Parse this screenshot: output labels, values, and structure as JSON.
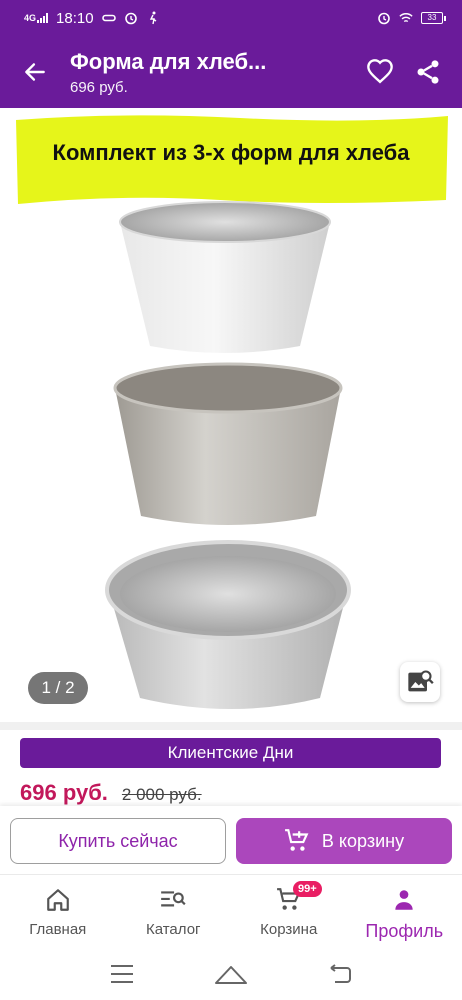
{
  "statusbar": {
    "network": "4G",
    "time": "18:10",
    "battery": "33"
  },
  "appbar": {
    "title": "Форма для хлеб...",
    "price": "696 руб."
  },
  "gallery": {
    "banner_text": "Комплект из 3-х форм для хлеба",
    "counter": "1 / 2"
  },
  "promo": {
    "label": "Клиентские Дни"
  },
  "pricing": {
    "current": "696 руб.",
    "old": "2 000 руб."
  },
  "actions": {
    "buy_now": "Купить сейчас",
    "add_to_cart": "В корзину"
  },
  "bottom_nav": {
    "items": [
      {
        "label": "Главная",
        "icon": "home-icon"
      },
      {
        "label": "Каталог",
        "icon": "catalog-icon"
      },
      {
        "label": "Корзина",
        "icon": "cart-icon",
        "badge": "99+"
      },
      {
        "label": "Профиль",
        "icon": "profile-icon",
        "active": true
      }
    ]
  },
  "colors": {
    "brand_purple": "#6a1b9a",
    "accent_pink": "#c2185b",
    "highlight_yellow": "#e6f51a",
    "cart_button": "#ab47bc"
  }
}
